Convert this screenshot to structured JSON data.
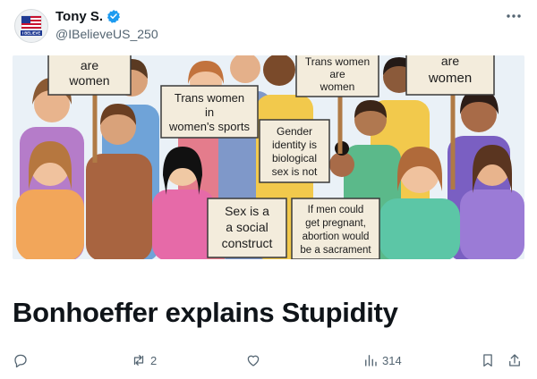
{
  "header": {
    "display_name": "Tony S.",
    "handle": "@IBelieveUS_250",
    "avatar_caption": "I BELIEVE"
  },
  "image": {
    "signs": [
      {
        "lines": [
          "are",
          "women"
        ]
      },
      {
        "lines": [
          "Trans women",
          "are",
          "women"
        ]
      },
      {
        "lines": [
          "are",
          "women"
        ]
      },
      {
        "lines": [
          "Trans women",
          "in",
          "women's sports"
        ]
      },
      {
        "lines": [
          "Gender",
          "identity is",
          "biological",
          "sex is not"
        ]
      },
      {
        "lines": [
          "Sex is a",
          "a social",
          "construct"
        ]
      },
      {
        "lines": [
          "If men could",
          "get pregnant,",
          "abortion would",
          "be a sacrament"
        ]
      }
    ]
  },
  "post": {
    "headline": "Bonhoeffer explains Stupidity"
  },
  "actions": {
    "reply_icon": "reply-icon",
    "repost_count": "2",
    "like_icon": "heart-icon",
    "views_count": "314",
    "bookmark_icon": "bookmark-icon",
    "share_icon": "share-icon"
  },
  "colors": {
    "verified": "#1d9bf0",
    "text_primary": "#0f1419",
    "text_secondary": "#536471"
  }
}
